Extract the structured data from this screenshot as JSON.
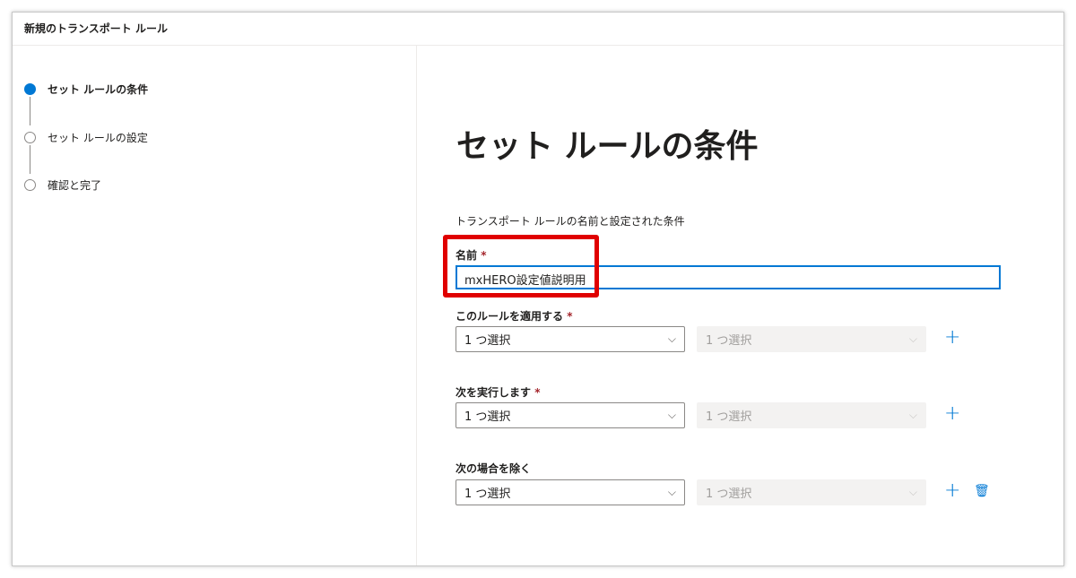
{
  "header": {
    "title": "新規のトランスポート ルール"
  },
  "steps": [
    {
      "label": "セット ルールの条件",
      "active": true
    },
    {
      "label": "セット ルールの設定",
      "active": false
    },
    {
      "label": "確認と完了",
      "active": false
    }
  ],
  "main": {
    "title": "セット ルールの条件",
    "subtitle": "トランスポート ルールの名前と設定された条件",
    "name": {
      "label": "名前",
      "required": "*",
      "value": "mxHERO設定値説明用"
    },
    "rows": [
      {
        "label": "このルールを適用する",
        "required": "*",
        "select1": "1 つ選択",
        "select2": "1 つ選択"
      },
      {
        "label": "次を実行します",
        "required": "*",
        "select1": "1 つ選択",
        "select2": "1 つ選択"
      },
      {
        "label": "次の場合を除く",
        "required": "",
        "select1": "1 つ選択",
        "select2": "1 つ選択"
      }
    ],
    "icons": {
      "chevron": "⌵",
      "plus": "+",
      "trash": "🗑"
    }
  },
  "colors": {
    "accent": "#0078d4",
    "highlight": "#e00000"
  }
}
